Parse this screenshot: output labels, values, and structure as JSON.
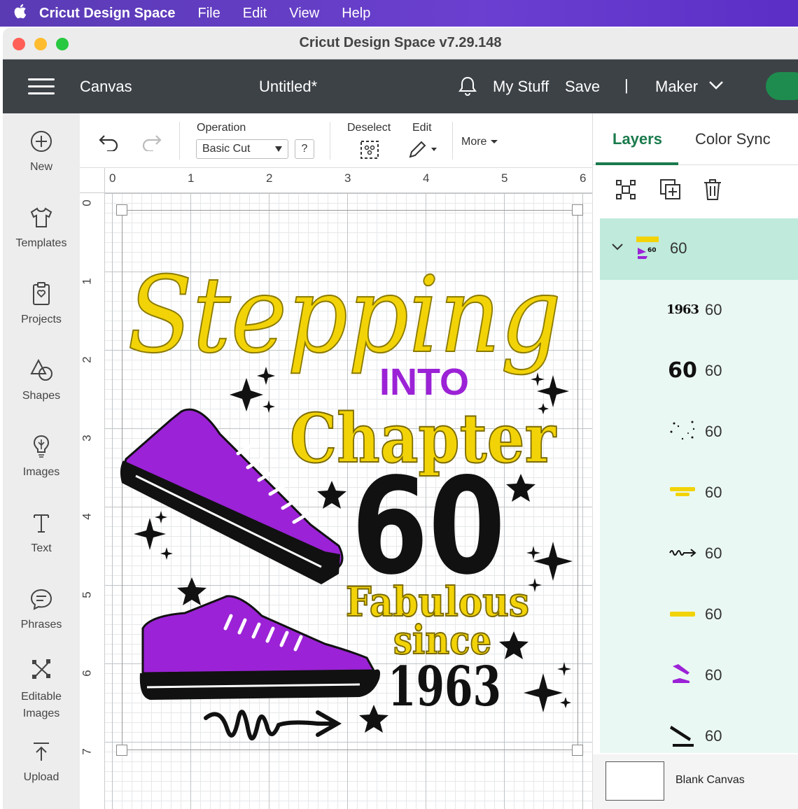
{
  "menubar": {
    "app_name": "Cricut Design Space",
    "items": [
      "File",
      "Edit",
      "View",
      "Help"
    ]
  },
  "window": {
    "title": "Cricut Design Space  v7.29.148"
  },
  "header": {
    "section": "Canvas",
    "project_title": "Untitled*",
    "my_stuff": "My Stuff",
    "save": "Save",
    "separator": "|",
    "machine": "Maker"
  },
  "sidebar": {
    "items": [
      {
        "label": "New",
        "icon": "plus-circle-icon"
      },
      {
        "label": "Templates",
        "icon": "shirt-icon"
      },
      {
        "label": "Projects",
        "icon": "projects-icon"
      },
      {
        "label": "Shapes",
        "icon": "shapes-icon"
      },
      {
        "label": "Images",
        "icon": "lightbulb-icon"
      },
      {
        "label": "Text",
        "icon": "text-icon"
      },
      {
        "label": "Phrases",
        "icon": "chat-icon"
      },
      {
        "label": "Editable Images",
        "icon": "edit-image-icon"
      },
      {
        "label": "Upload",
        "icon": "upload-icon"
      }
    ]
  },
  "toolbar": {
    "operation_label": "Operation",
    "operation_value": "Basic Cut",
    "help": "?",
    "deselect": "Deselect",
    "edit": "Edit",
    "more": "More"
  },
  "rulers": {
    "top": [
      "0",
      "1",
      "2",
      "3",
      "4",
      "5",
      "6"
    ],
    "left": [
      "0",
      "1",
      "2",
      "3",
      "4",
      "5",
      "6",
      "7"
    ]
  },
  "design": {
    "line1": "Stepping",
    "line2": "INTO",
    "line3": "Chapter",
    "line4": "60",
    "line5": "Fabulous",
    "line6": "since",
    "line7": "1963",
    "colors": {
      "yellow": "#f2d308",
      "purple": "#9b22d6",
      "black": "#111111"
    }
  },
  "panel": {
    "tabs": [
      "Layers",
      "Color Sync"
    ],
    "group": {
      "name": "60"
    },
    "layers": [
      {
        "name": "60",
        "thumb": "1963-text"
      },
      {
        "name": "60",
        "thumb": "60-text"
      },
      {
        "name": "60",
        "thumb": "stars"
      },
      {
        "name": "60",
        "thumb": "fabulous-since-text"
      },
      {
        "name": "60",
        "thumb": "squiggle-arrow"
      },
      {
        "name": "60",
        "thumb": "chapter-text"
      },
      {
        "name": "60",
        "thumb": "purple-shoes"
      },
      {
        "name": "60",
        "thumb": "black-soles"
      }
    ],
    "thumb_texts": {
      "t1963": "1963",
      "t60": "60"
    },
    "blank_canvas": "Blank Canvas"
  }
}
